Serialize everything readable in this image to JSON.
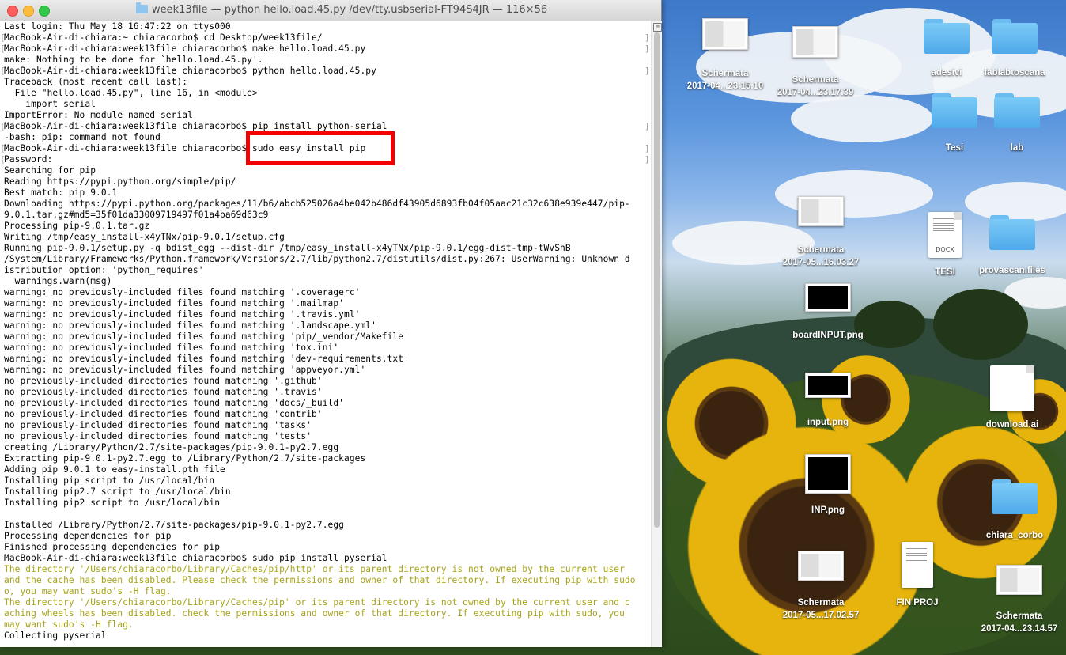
{
  "window": {
    "title": "week13file — python hello.load.45.py /dev/tty.usbserial-FT94S4JR — 116×56",
    "title_icon": "folder-icon"
  },
  "terminal": {
    "lines": [
      {
        "text": "Last login: Thu May 18 16:47:22 on ttys000",
        "style": "normal"
      },
      {
        "text": "MacBook-Air-di-chiara:~ chiaracorbo$ cd Desktop/week13file/",
        "style": "mark"
      },
      {
        "text": "MacBook-Air-di-chiara:week13file chiaracorbo$ make hello.load.45.py",
        "style": "mark"
      },
      {
        "text": "make: Nothing to be done for `hello.load.45.py'.",
        "style": "normal"
      },
      {
        "text": "MacBook-Air-di-chiara:week13file chiaracorbo$ python hello.load.45.py",
        "style": "mark"
      },
      {
        "text": "Traceback (most recent call last):",
        "style": "normal"
      },
      {
        "text": "  File \"hello.load.45.py\", line 16, in <module>",
        "style": "normal"
      },
      {
        "text": "    import serial",
        "style": "normal"
      },
      {
        "text": "ImportError: No module named serial",
        "style": "normal"
      },
      {
        "text": "MacBook-Air-di-chiara:week13file chiaracorbo$ pip install python-serial",
        "style": "mark"
      },
      {
        "text": "-bash: pip: command not found",
        "style": "normal"
      },
      {
        "text": "MacBook-Air-di-chiara:week13file chiaracorbo$ sudo easy_install pip",
        "style": "mark"
      },
      {
        "text": "Password:",
        "style": "mark"
      },
      {
        "text": "Searching for pip",
        "style": "normal"
      },
      {
        "text": "Reading https://pypi.python.org/simple/pip/",
        "style": "normal"
      },
      {
        "text": "Best match: pip 9.0.1",
        "style": "normal"
      },
      {
        "text": "Downloading https://pypi.python.org/packages/11/b6/abcb525026a4be042b486df43905d6893fb04f05aac21c32c638e939e447/pip-",
        "style": "normal"
      },
      {
        "text": "9.0.1.tar.gz#md5=35f01da33009719497f01a4ba69d63c9",
        "style": "normal"
      },
      {
        "text": "Processing pip-9.0.1.tar.gz",
        "style": "normal"
      },
      {
        "text": "Writing /tmp/easy_install-x4yTNx/pip-9.0.1/setup.cfg",
        "style": "normal"
      },
      {
        "text": "Running pip-9.0.1/setup.py -q bdist_egg --dist-dir /tmp/easy_install-x4yTNx/pip-9.0.1/egg-dist-tmp-tWvShB",
        "style": "normal"
      },
      {
        "text": "/System/Library/Frameworks/Python.framework/Versions/2.7/lib/python2.7/distutils/dist.py:267: UserWarning: Unknown d",
        "style": "normal"
      },
      {
        "text": "istribution option: 'python_requires'",
        "style": "normal"
      },
      {
        "text": "  warnings.warn(msg)",
        "style": "normal"
      },
      {
        "text": "warning: no previously-included files found matching '.coveragerc'",
        "style": "normal"
      },
      {
        "text": "warning: no previously-included files found matching '.mailmap'",
        "style": "normal"
      },
      {
        "text": "warning: no previously-included files found matching '.travis.yml'",
        "style": "normal"
      },
      {
        "text": "warning: no previously-included files found matching '.landscape.yml'",
        "style": "normal"
      },
      {
        "text": "warning: no previously-included files found matching 'pip/_vendor/Makefile'",
        "style": "normal"
      },
      {
        "text": "warning: no previously-included files found matching 'tox.ini'",
        "style": "normal"
      },
      {
        "text": "warning: no previously-included files found matching 'dev-requirements.txt'",
        "style": "normal"
      },
      {
        "text": "warning: no previously-included files found matching 'appveyor.yml'",
        "style": "normal"
      },
      {
        "text": "no previously-included directories found matching '.github'",
        "style": "normal"
      },
      {
        "text": "no previously-included directories found matching '.travis'",
        "style": "normal"
      },
      {
        "text": "no previously-included directories found matching 'docs/_build'",
        "style": "normal"
      },
      {
        "text": "no previously-included directories found matching 'contrib'",
        "style": "normal"
      },
      {
        "text": "no previously-included directories found matching 'tasks'",
        "style": "normal"
      },
      {
        "text": "no previously-included directories found matching 'tests'",
        "style": "normal"
      },
      {
        "text": "creating /Library/Python/2.7/site-packages/pip-9.0.1-py2.7.egg",
        "style": "normal"
      },
      {
        "text": "Extracting pip-9.0.1-py2.7.egg to /Library/Python/2.7/site-packages",
        "style": "normal"
      },
      {
        "text": "Adding pip 9.0.1 to easy-install.pth file",
        "style": "normal"
      },
      {
        "text": "Installing pip script to /usr/local/bin",
        "style": "normal"
      },
      {
        "text": "Installing pip2.7 script to /usr/local/bin",
        "style": "normal"
      },
      {
        "text": "Installing pip2 script to /usr/local/bin",
        "style": "normal"
      },
      {
        "text": "",
        "style": "normal"
      },
      {
        "text": "Installed /Library/Python/2.7/site-packages/pip-9.0.1-py2.7.egg",
        "style": "normal"
      },
      {
        "text": "Processing dependencies for pip",
        "style": "normal"
      },
      {
        "text": "Finished processing dependencies for pip",
        "style": "normal"
      },
      {
        "text": "MacBook-Air-di-chiara:week13file chiaracorbo$ sudo pip install pyserial",
        "style": "normal"
      },
      {
        "text": "The directory '/Users/chiaracorbo/Library/Caches/pip/http' or its parent directory is not owned by the current user",
        "style": "warn"
      },
      {
        "text": "and the cache has been disabled. Please check the permissions and owner of that directory. If executing pip with sudo",
        "style": "warn"
      },
      {
        "text": "o, you may want sudo's -H flag.",
        "style": "warn"
      },
      {
        "text": "The directory '/Users/chiaracorbo/Library/Caches/pip' or its parent directory is not owned by the current user and c",
        "style": "warn"
      },
      {
        "text": "aching wheels has been disabled. check the permissions and owner of that directory. If executing pip with sudo, you",
        "style": "warn"
      },
      {
        "text": "may want sudo's -H flag.",
        "style": "warn"
      },
      {
        "text": "Collecting pyserial",
        "style": "normal"
      }
    ],
    "highlight_color": "#f50000",
    "warn_color": "#a6a315"
  },
  "desktop": {
    "icons": [
      {
        "label1": "Schermata",
        "label2": "2017-04...23.15.10",
        "kind": "screenshot"
      },
      {
        "label1": "Schermata",
        "label2": "2017-04...23.17.39",
        "kind": "screenshot"
      },
      {
        "label1": "adesivi",
        "label2": "",
        "kind": "folder"
      },
      {
        "label1": "fablabtoscana",
        "label2": "",
        "kind": "folder"
      },
      {
        "label1": "Tesi",
        "label2": "",
        "kind": "folder"
      },
      {
        "label1": "lab",
        "label2": "",
        "kind": "folder"
      },
      {
        "label1": "Schermata",
        "label2": "2017-05...16.03.27",
        "kind": "screenshot"
      },
      {
        "label1": "TESI",
        "label2": "",
        "kind": "docx",
        "tag": "DOCX"
      },
      {
        "label1": "provascan.files",
        "label2": "",
        "kind": "folder"
      },
      {
        "label1": "boardINPUT.png",
        "label2": "",
        "kind": "image-dark"
      },
      {
        "label1": "input.png",
        "label2": "",
        "kind": "image-dark"
      },
      {
        "label1": "download.ai",
        "label2": "",
        "kind": "document"
      },
      {
        "label1": "INP.png",
        "label2": "",
        "kind": "image-dark"
      },
      {
        "label1": "chiara_corbo",
        "label2": "",
        "kind": "folder"
      },
      {
        "label1": "Schermata",
        "label2": "2017-05...17.02.57",
        "kind": "screenshot"
      },
      {
        "label1": "FIN PROJ",
        "label2": "",
        "kind": "document"
      },
      {
        "label1": "Schermata",
        "label2": "2017-04...23.14.57",
        "kind": "screenshot"
      }
    ]
  }
}
